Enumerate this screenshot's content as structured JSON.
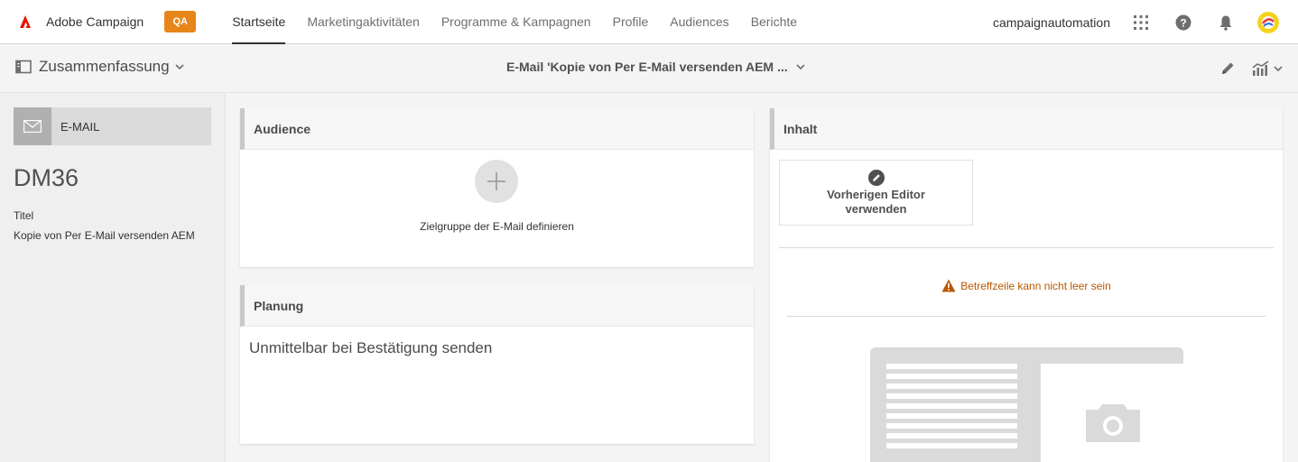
{
  "app": {
    "name": "Adobe Campaign",
    "env_badge": "QA"
  },
  "nav": {
    "items": [
      {
        "label": "Startseite",
        "active": true
      },
      {
        "label": "Marketingaktivitäten",
        "active": false
      },
      {
        "label": "Programme & Kampagnen",
        "active": false
      },
      {
        "label": "Profile",
        "active": false
      },
      {
        "label": "Audiences",
        "active": false
      },
      {
        "label": "Berichte",
        "active": false
      }
    ]
  },
  "user": {
    "name": "campaignautomation"
  },
  "icons": {
    "apps": "apps-grid-icon",
    "help": "help-icon",
    "notifications": "bell-icon",
    "edit": "pencil-icon",
    "reports": "chart-icon"
  },
  "subheader": {
    "summary_label": "Zusammenfassung",
    "breadcrumb": "E-Mail 'Kopie von Per E-Mail versenden AEM ..."
  },
  "sidebar": {
    "type_label": "E-MAIL",
    "label_code": "DM36",
    "title_key": "Titel",
    "title_value": "Kopie von Per E-Mail versenden AEM"
  },
  "audience": {
    "heading": "Audience",
    "hint": "Zielgruppe der E-Mail definieren"
  },
  "planning": {
    "heading": "Planung",
    "text": "Unmittelbar bei Bestätigung senden"
  },
  "content": {
    "heading": "Inhalt",
    "editor_button": "Vorherigen Editor verwenden",
    "warning": "Betreffzeile kann nicht leer sein"
  },
  "colors": {
    "accent_badge": "#e68619",
    "warning": "#b85700",
    "adobe_red": "#eb1000"
  }
}
